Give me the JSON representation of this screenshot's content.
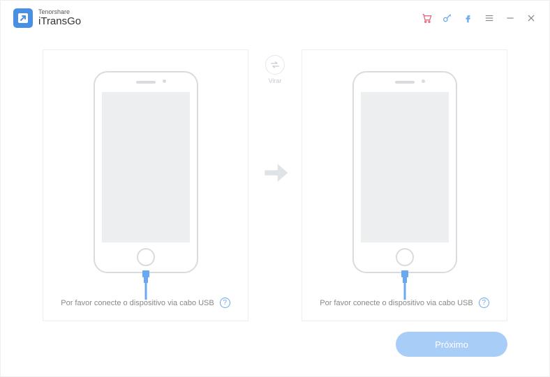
{
  "brand": {
    "company": "Tenorshare",
    "product": "iTransGo"
  },
  "header": {
    "cart_icon": "cart-icon",
    "key_icon": "key-icon",
    "facebook_icon": "facebook-icon",
    "menu_icon": "menu-icon",
    "minimize_icon": "minimize-icon",
    "close_icon": "close-icon"
  },
  "flip": {
    "label": "Virar"
  },
  "left_panel": {
    "prompt": "Por favor conecte o dispositivo via cabo USB",
    "help": "?"
  },
  "right_panel": {
    "prompt": "Por favor conecte o dispositivo via cabo USB",
    "help": "?"
  },
  "next_button": {
    "label": "Próximo"
  },
  "colors": {
    "accent": "#4a90e2",
    "cart": "#e66a7a",
    "key": "#6aa8f0",
    "facebook": "#6aa8f0",
    "next_bg": "#a8cdf7"
  }
}
